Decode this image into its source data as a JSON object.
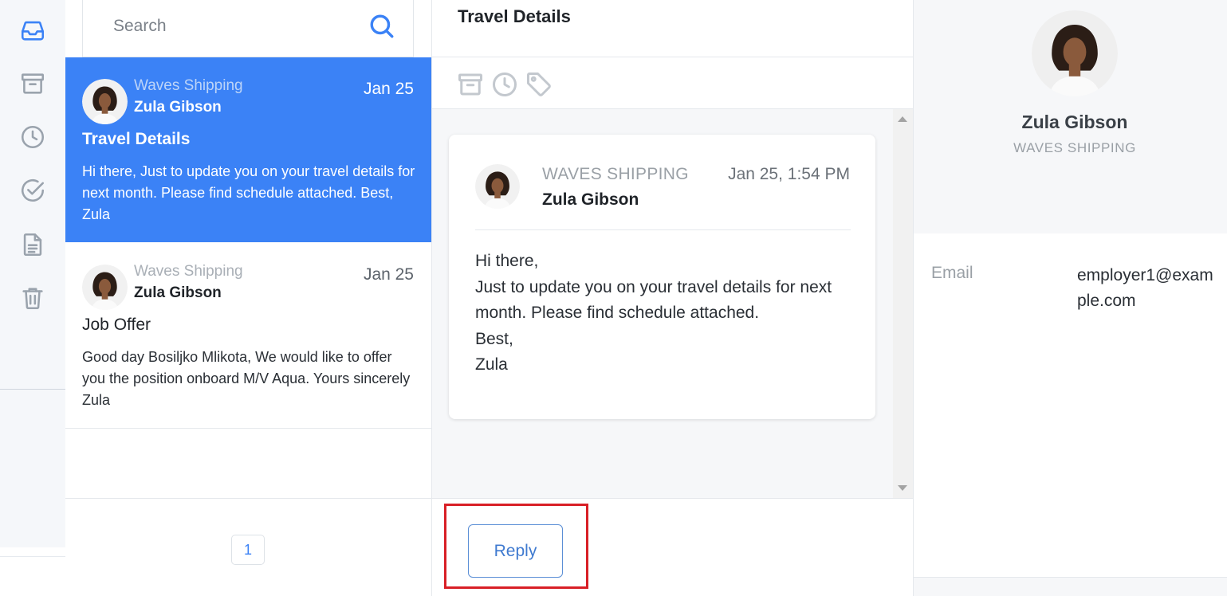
{
  "colors": {
    "accent": "#3b82f6",
    "highlight_border": "#d81f26"
  },
  "sidebar": {
    "items": [
      {
        "icon": "inbox-icon",
        "active": true
      },
      {
        "icon": "archive-icon",
        "active": false
      },
      {
        "icon": "clock-icon",
        "active": false
      },
      {
        "icon": "check-circle-icon",
        "active": false
      },
      {
        "icon": "document-icon",
        "active": false
      },
      {
        "icon": "trash-icon",
        "active": false
      }
    ]
  },
  "search": {
    "placeholder": "Search",
    "value": ""
  },
  "messages": [
    {
      "company": "Waves Shipping",
      "sender": "Zula Gibson",
      "date": "Jan 25",
      "subject": "Travel Details",
      "preview": "Hi there, Just to update you on your travel details for next month. Please find schedule attached. Best, Zula",
      "selected": true
    },
    {
      "company": "Waves Shipping",
      "sender": "Zula Gibson",
      "date": "Jan 25",
      "subject": "Job Offer",
      "preview": "Good day Bosiljko Mlikota, We would like to offer you the position onboard M/V Aqua. Yours sincerely Zula",
      "selected": false
    }
  ],
  "pagination": {
    "current_page": "1"
  },
  "detail": {
    "title": "Travel Details",
    "toolbar": [
      "archive-icon",
      "clock-icon",
      "tag-icon"
    ],
    "message": {
      "company": "WAVES SHIPPING",
      "sender": "Zula Gibson",
      "datetime": "Jan 25, 1:54 PM",
      "body_lines": [
        "Hi there,",
        "Just to update you on your travel details for next month. Please find schedule attached.",
        "Best,",
        "Zula"
      ]
    },
    "reply_label": "Reply"
  },
  "contact": {
    "name": "Zula Gibson",
    "company": "WAVES SHIPPING",
    "email_label": "Email",
    "email_value": "employer1@example.com"
  }
}
